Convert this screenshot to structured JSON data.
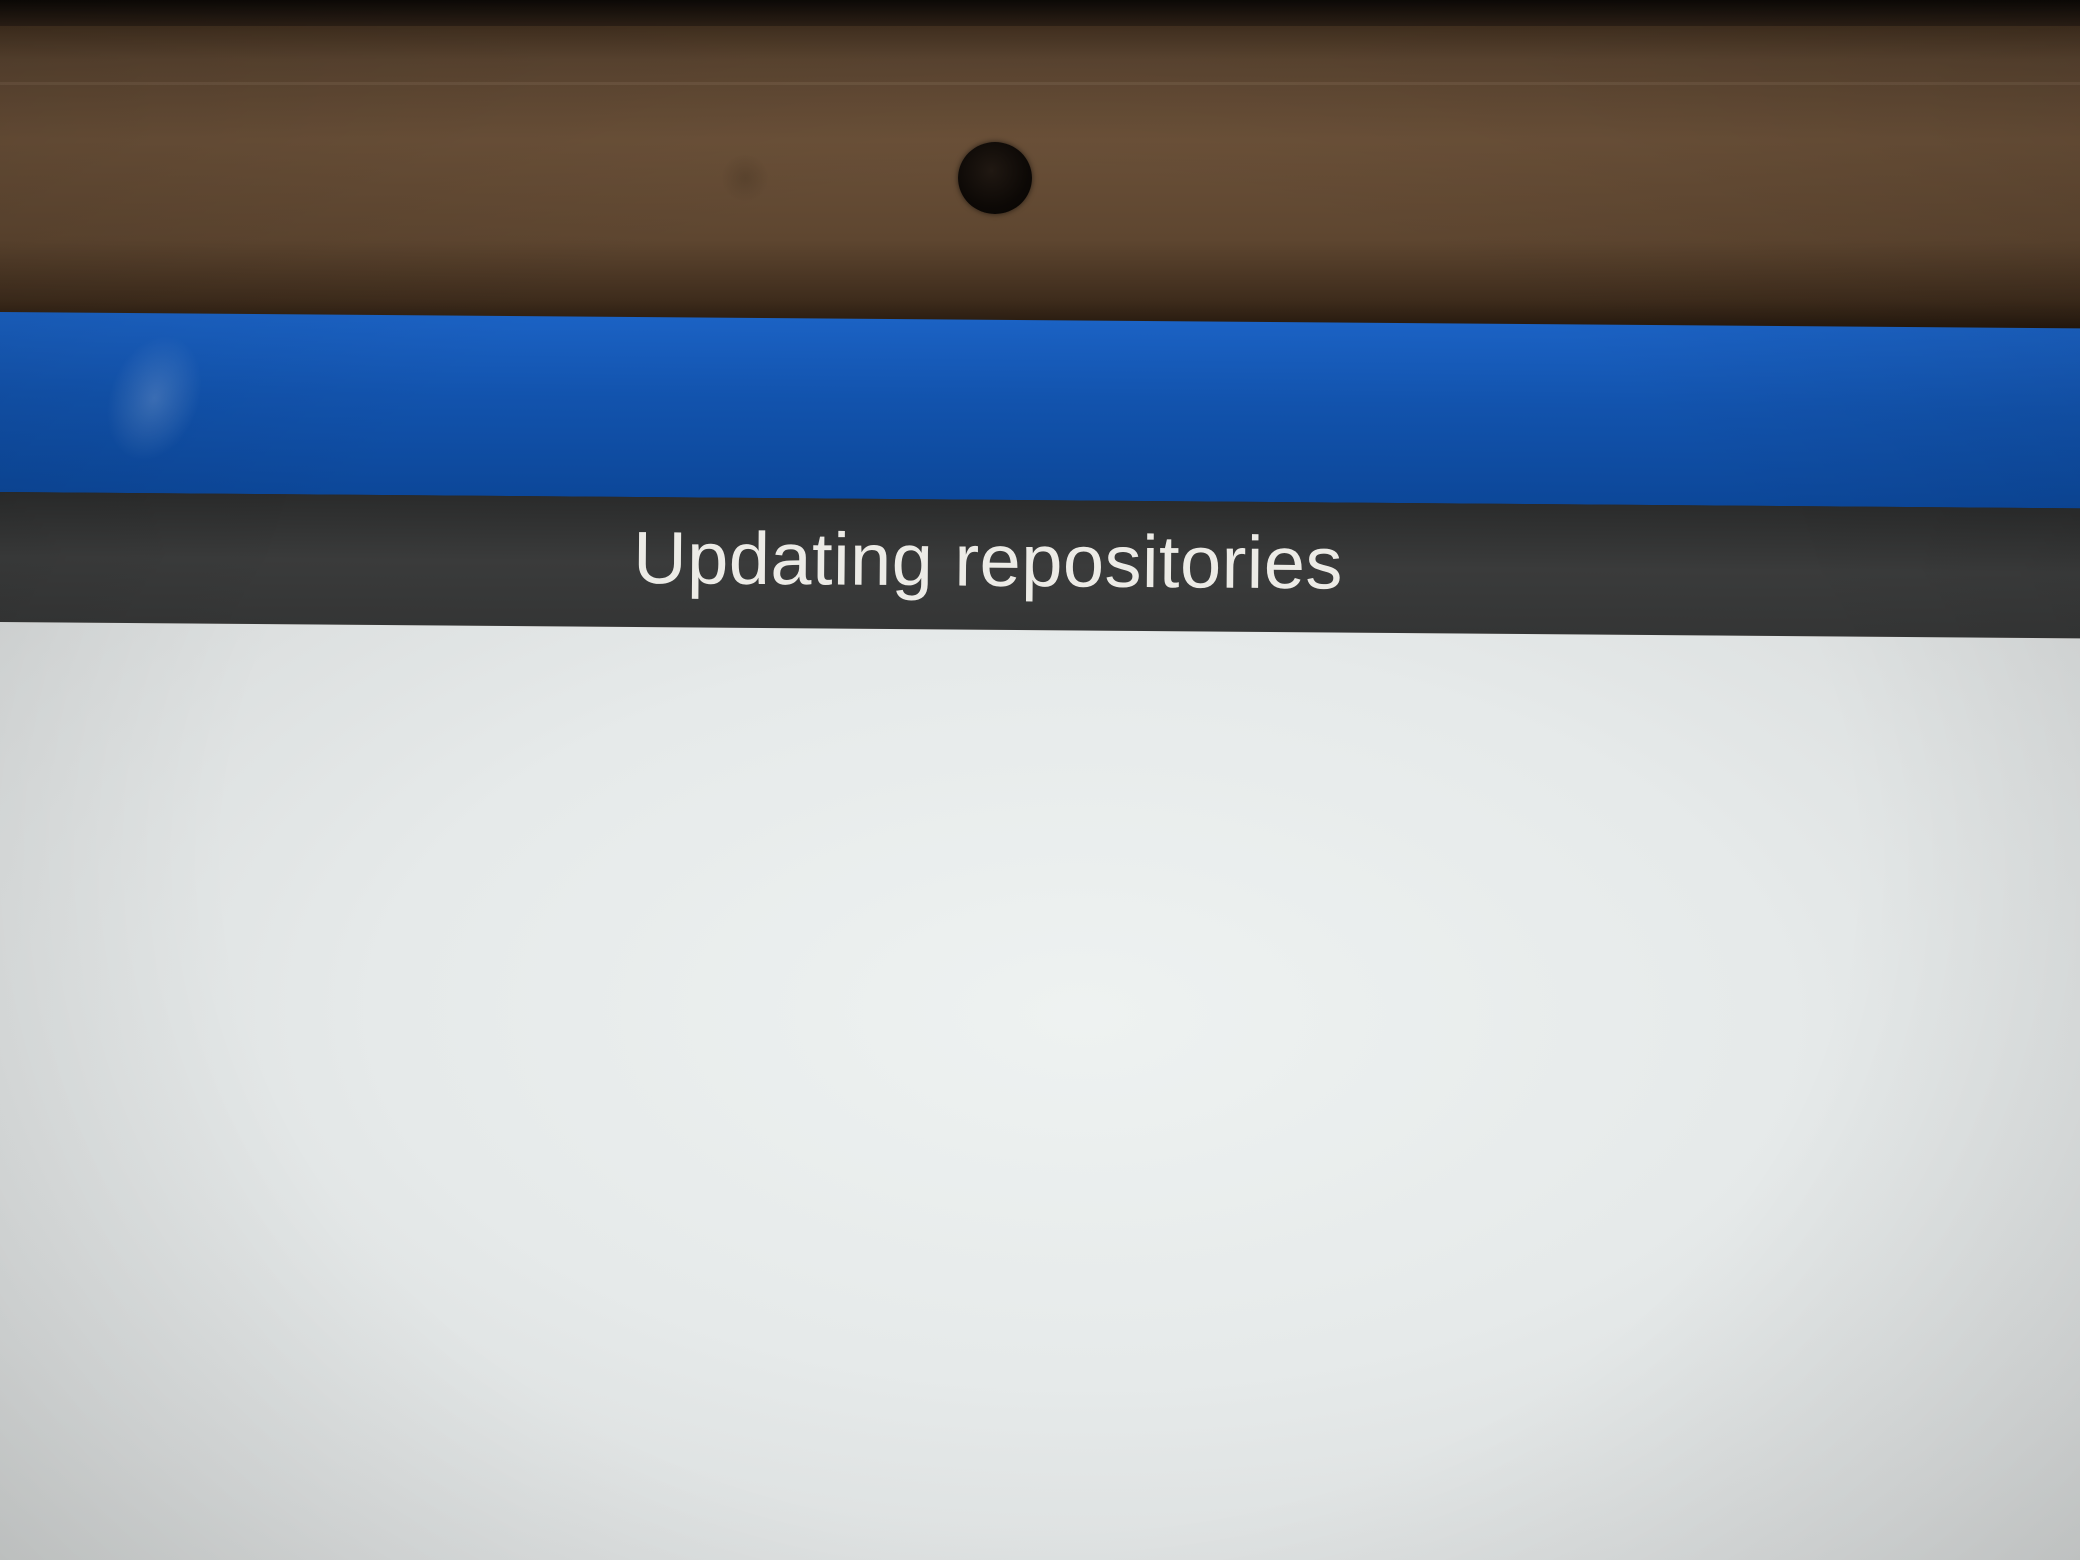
{
  "status": {
    "message": "Updating repositories"
  },
  "colors": {
    "app_bar": "#1253ad",
    "status_bar": "#363737",
    "content_background": "#e6eaea",
    "status_text": "#ecebe6"
  },
  "icons": {
    "camera": "front-camera-icon",
    "sensor": "light-sensor-icon"
  }
}
